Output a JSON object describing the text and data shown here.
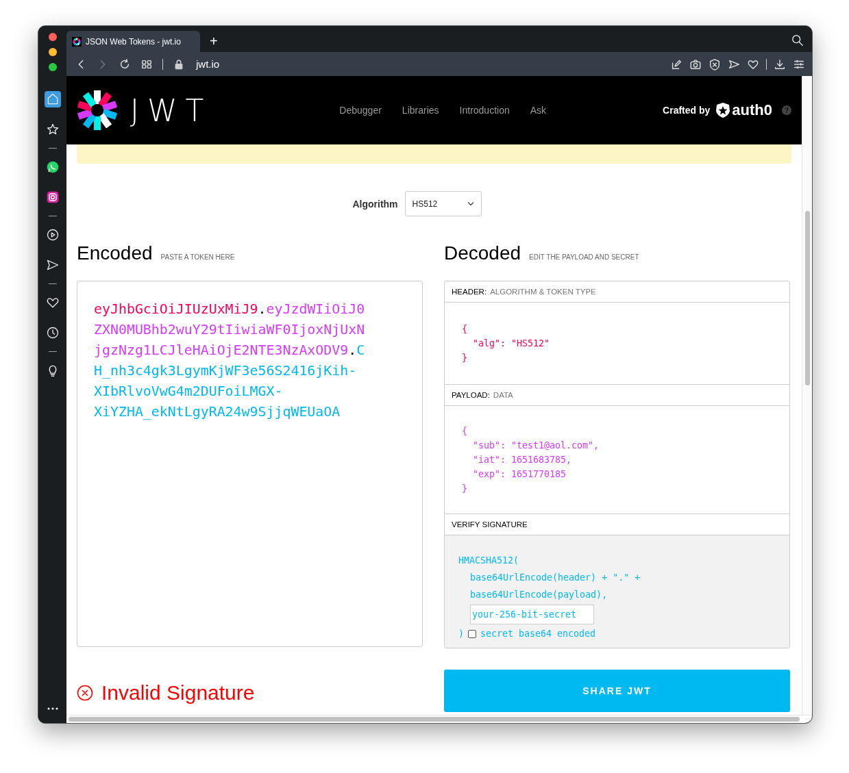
{
  "browser": {
    "tabs": [
      {
        "title": "JSON Web Tokens - jwt.io",
        "selected": true
      }
    ],
    "new_tab": "+",
    "address": "jwt.io"
  },
  "sidebar": {
    "items": [
      {
        "selected": true
      },
      {
        "selected": false
      },
      {
        "selected": false
      },
      {
        "selected": false
      },
      {
        "selected": false
      },
      {
        "selected": false
      },
      {
        "selected": false
      },
      {
        "selected": false
      },
      {
        "selected": false
      }
    ]
  },
  "site_header": {
    "logo_text": "JWT",
    "nav": [
      "Debugger",
      "Libraries",
      "Introduction",
      "Ask"
    ],
    "crafted_by": "Crafted by",
    "brand": "auth0",
    "help": "?"
  },
  "algorithm": {
    "label": "Algorithm",
    "value": "HS512"
  },
  "encoded": {
    "title": "Encoded",
    "hint": "PASTE A TOKEN HERE",
    "separator": ".",
    "segments": [
      {
        "text": "eyJhbGciOiJIUzUxMiJ9",
        "color": "#fb015b"
      },
      {
        "text": "eyJzdWIiOiJ0ZXN0MUBhb2wuY29tIiwiaWF0IjoxNjUxNjgzNzg1LCJleHAiOjE2NTE3NzAxODV9",
        "color": "#d63aff"
      },
      {
        "text": "CH_nh3c4gk3LgymKjWF3e56S2416jKih-XIbRlvoVwG4m2DUFoiLMGX-XiYZHA_ekNtLgyRA24w9SjjqWEUaOA",
        "color": "#00b9f1"
      }
    ]
  },
  "decoded": {
    "title": "Decoded",
    "hint": "EDIT THE PAYLOAD AND SECRET",
    "sections": [
      {
        "kind": "json",
        "label": "HEADER:",
        "sublabel": "ALGORITHM & TOKEN TYPE",
        "color": "#fb015b",
        "open": "{",
        "entries": [
          "\"alg\": \"HS512\""
        ],
        "close": "}"
      },
      {
        "kind": "json",
        "label": "PAYLOAD:",
        "sublabel": "DATA",
        "color": "#d63aff",
        "open": "{",
        "entries": [
          "\"sub\": \"test1@aol.com\",",
          "\"iat\": 1651683785,",
          "\"exp\": 1651770185"
        ],
        "close": "}"
      },
      {
        "kind": "signature",
        "label": "VERIFY SIGNATURE",
        "color": "#00b9f1",
        "open": "HMACSHA512(",
        "args": [
          "base64UrlEncode(header) + \".\" +",
          "base64UrlEncode(payload),"
        ],
        "secret": "your-256-bit-secret",
        "close": ")",
        "checkbox": {
          "label": "secret base64 encoded",
          "checked": false
        }
      }
    ]
  },
  "status": {
    "text": "Invalid Signature",
    "valid": false
  },
  "share_button": "SHARE JWT"
}
